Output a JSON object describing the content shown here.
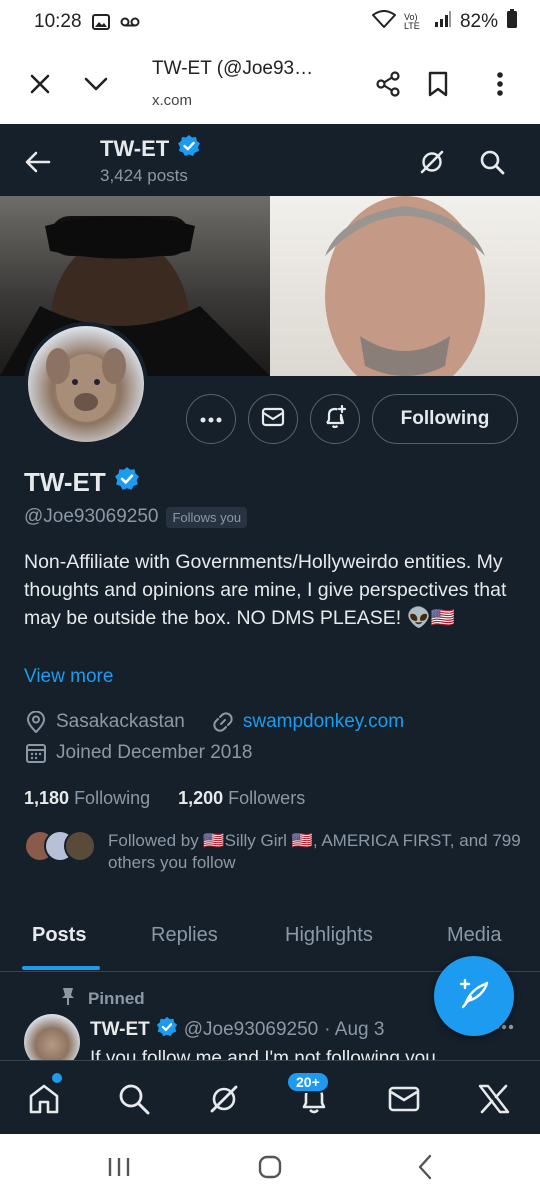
{
  "status_bar": {
    "time": "10:28",
    "battery": "82%",
    "network": "Vo) LTE"
  },
  "browser": {
    "title": "TW-ET (@Joe93…",
    "domain": "x.com"
  },
  "header": {
    "name": "TW-ET",
    "posts_count": "3,424 posts"
  },
  "profile": {
    "name": "TW-ET",
    "handle": "@Joe93069250",
    "follows_you": "Follows you",
    "following_button": "Following",
    "bio": "Non-Affiliate with Governments/Hollyweirdo entities.  My thoughts and opinions are mine, I give perspectives that may be outside the box.  NO DMS PLEASE! 👽🇺🇸",
    "view_more": "View more",
    "location": "Sasakackastan",
    "website": "swampdonkey.com",
    "joined": "Joined December 2018",
    "following_count": "1,180",
    "following_label": "Following",
    "followers_count": "1,200",
    "followers_label": "Followers",
    "followed_by": "Followed by 🇺🇸Silly Girl 🇺🇸, AMERICA FIRST, and 799 others you follow"
  },
  "tabs": [
    {
      "label": "Posts",
      "active": true
    },
    {
      "label": "Replies",
      "active": false
    },
    {
      "label": "Highlights",
      "active": false
    },
    {
      "label": "Media",
      "active": false
    }
  ],
  "pinned_tweet": {
    "pinned_label": "Pinned",
    "name": "TW-ET",
    "handle": "@Joe93069250",
    "date": "· Aug 3",
    "text": "If you follow me and I'm not following you"
  },
  "bottom_nav": {
    "notifications_badge": "20+"
  },
  "colors": {
    "background": "#15202b",
    "accent": "#1d9bf0",
    "muted_text": "#8b98a5",
    "border": "#38444d"
  },
  "icons": [
    "close-icon",
    "chevron-down-icon",
    "share-icon",
    "bookmark-icon",
    "more-vert-icon",
    "back-arrow-icon",
    "grok-icon",
    "search-icon",
    "more-icon",
    "mail-icon",
    "bell-plus-icon",
    "verified-icon",
    "location-icon",
    "link-icon",
    "calendar-icon",
    "pin-icon",
    "compose-icon",
    "home-icon",
    "bell-icon",
    "x-logo-icon"
  ]
}
